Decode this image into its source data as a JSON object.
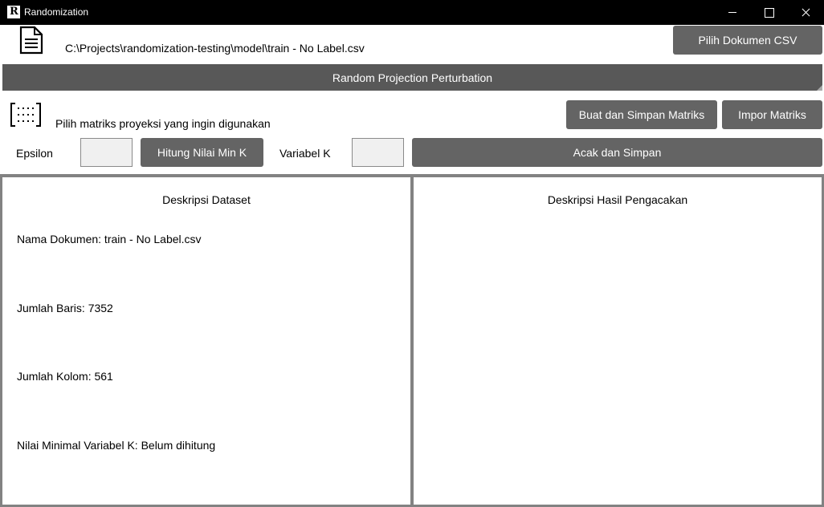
{
  "window": {
    "title": "Randomization",
    "app_icon_letter": "R"
  },
  "file": {
    "path": "C:\\Projects\\randomization-testing\\model\\train - No Label.csv",
    "choose_button": "Pilih Dokumen CSV"
  },
  "section": {
    "title": "Random Projection Perturbation"
  },
  "matrix": {
    "prompt": "Pilih matriks proyeksi yang ingin digunakan",
    "create_button": "Buat dan Simpan Matriks",
    "import_button": "Impor Matriks"
  },
  "params": {
    "epsilon_label": "Epsilon",
    "epsilon_value": "",
    "compute_button": "Hitung Nilai Min K",
    "k_label": "Variabel K",
    "k_value": "",
    "randomize_button": "Acak dan Simpan"
  },
  "dataset_panel": {
    "title": "Deskripsi Dataset",
    "doc_name": "Nama Dokumen: train - No Label.csv",
    "rows": "Jumlah Baris: 7352",
    "cols": "Jumlah Kolom: 561",
    "min_k": "Nilai Minimal Variabel K: Belum dihitung"
  },
  "result_panel": {
    "title": "Deskripsi Hasil Pengacakan"
  },
  "icons": {
    "app": "app-icon",
    "file": "document-icon",
    "matrix": "matrix-icon",
    "minimize": "minimize-icon",
    "maximize": "maximize-icon",
    "close": "close-icon"
  }
}
